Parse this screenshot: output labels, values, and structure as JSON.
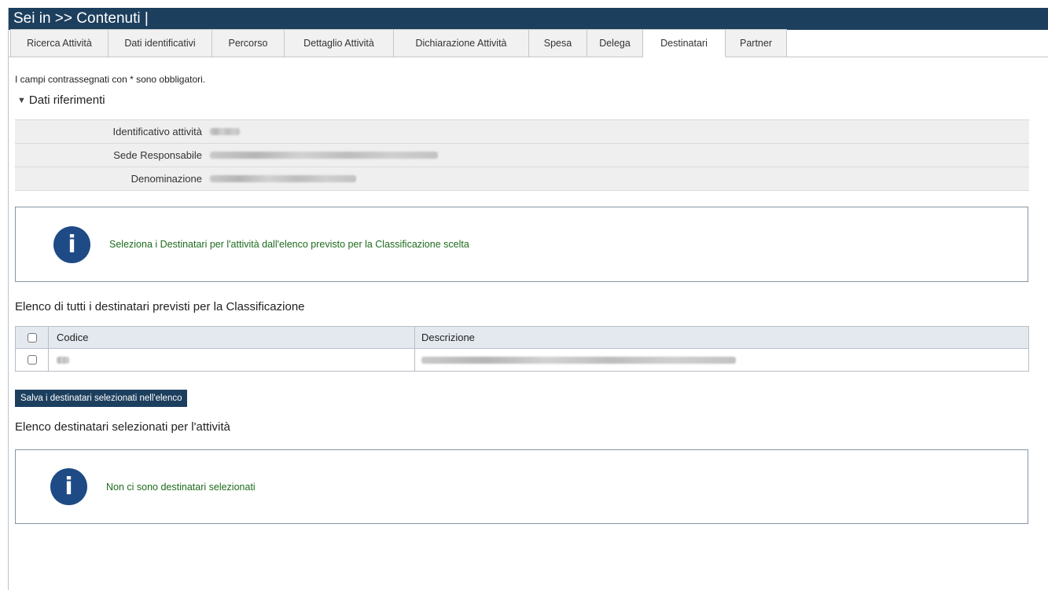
{
  "header": {
    "title": "Sei in >> Contenuti |"
  },
  "tabs": [
    {
      "label": "Ricerca Attività",
      "active": false
    },
    {
      "label": "Dati identificativi",
      "active": false
    },
    {
      "label": "Percorso",
      "active": false
    },
    {
      "label": "Dettaglio Attività",
      "active": false
    },
    {
      "label": "Dichiarazione Attività",
      "active": false
    },
    {
      "label": "Spesa",
      "active": false
    },
    {
      "label": "Delega",
      "active": false
    },
    {
      "label": "Destinatari",
      "active": true
    },
    {
      "label": "Partner",
      "active": false
    }
  ],
  "required_note": "I campi contrassegnati con * sono obbligatori.",
  "section": {
    "title": "Dati riferimenti",
    "rows": [
      {
        "label": "Identificativo attività"
      },
      {
        "label": "Sede Responsabile"
      },
      {
        "label": "Denominazione"
      }
    ]
  },
  "info1": {
    "text": "Seleziona i Destinatari per l'attività dall'elenco previsto per la Classificazione scelta",
    "icon": "info-icon"
  },
  "list_all": {
    "title": "Elenco di tutti i destinatari previsti per la Classificazione",
    "columns": [
      "Codice",
      "Descrizione"
    ]
  },
  "save_button": "Salva i destinatari selezionati nell'elenco",
  "list_selected": {
    "title": "Elenco destinatari selezionati per l'attività"
  },
  "info2": {
    "text": "Non ci sono destinatari selezionati",
    "icon": "info-icon"
  },
  "colors": {
    "header_bg": "#1d3f5e",
    "info_icon": "#1e4a85",
    "info_text": "#1e6b1e"
  }
}
